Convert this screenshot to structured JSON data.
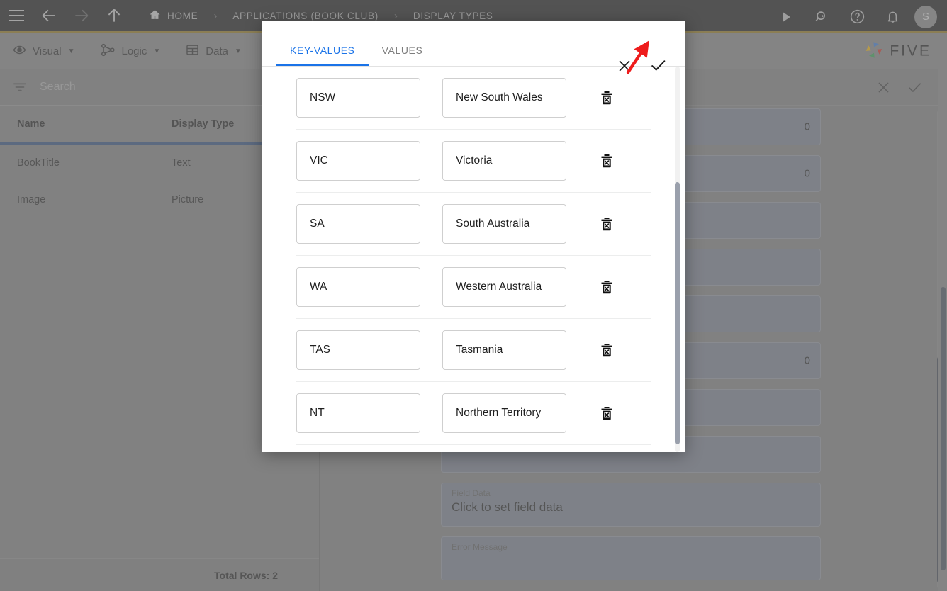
{
  "topbar": {
    "menu_icon": "hamburger-icon",
    "back_icon": "arrow-left-icon",
    "forward_icon": "arrow-right-icon",
    "up_icon": "arrow-up-icon",
    "breadcrumbs": [
      {
        "label": "HOME",
        "icon": "home-icon"
      },
      {
        "label": "APPLICATIONS (BOOK CLUB)",
        "icon": ""
      },
      {
        "label": "DISPLAY TYPES",
        "icon": ""
      }
    ],
    "separator": "›",
    "actions": [
      {
        "name": "run-icon",
        "glyph": "play"
      },
      {
        "name": "search-global-icon",
        "glyph": "search"
      },
      {
        "name": "help-icon",
        "glyph": "help"
      },
      {
        "name": "notifications-icon",
        "glyph": "bell"
      }
    ],
    "avatar_initial": "S",
    "accent_underline": "#9a7c1d"
  },
  "toolbar": {
    "items": [
      {
        "label": "Visual",
        "icon": "eye-icon",
        "caret": "▼"
      },
      {
        "label": "Logic",
        "icon": "logic-nodes-icon",
        "caret": "▼"
      },
      {
        "label": "Data",
        "icon": "grid-table-icon",
        "caret": "▼"
      }
    ],
    "brand": "FIVE",
    "brand_colors": [
      "#3b7ddd",
      "#d93025",
      "#34a853",
      "#fbbc04"
    ]
  },
  "left_panel": {
    "search": {
      "placeholder": "Search",
      "value": "",
      "filter_icon": "filter-icon"
    },
    "columns": [
      "Name",
      "Display Type"
    ],
    "rows": [
      {
        "name": "BookTitle",
        "display_type": "Text"
      },
      {
        "name": "Image",
        "display_type": "Picture"
      }
    ],
    "footer": "Total Rows: 2"
  },
  "right_panel": {
    "actions": [
      {
        "name": "cancel-record-icon",
        "glyph": "✕"
      },
      {
        "name": "save-record-icon",
        "glyph": "✓"
      }
    ],
    "fields": [
      {
        "label": "",
        "value_right": "0",
        "value_left": ""
      },
      {
        "label": "",
        "value_right": "0",
        "value_left": ""
      },
      {
        "label": "",
        "value_right": "",
        "value_left": ""
      },
      {
        "label": "",
        "value_right": "",
        "value_left": ""
      },
      {
        "label": "",
        "value_right": "",
        "value_left": ""
      },
      {
        "label": "",
        "value_right": "0",
        "value_left": ""
      },
      {
        "label": "",
        "value_right": "",
        "value_left": ""
      },
      {
        "label": "",
        "value_right": "",
        "value_left": ""
      },
      {
        "label": "Field Data",
        "value_right": "",
        "value_left": "Click to set field data"
      },
      {
        "label": "Error Message",
        "value_right": "",
        "value_left": ""
      }
    ]
  },
  "modal": {
    "tabs": [
      {
        "label": "KEY-VALUES",
        "active": true
      },
      {
        "label": "VALUES",
        "active": false
      }
    ],
    "close_label": "✕",
    "confirm_label": "✓",
    "active_tab_color": "#1a73e8",
    "delete_icon": "trash-delete-icon",
    "rows": [
      {
        "key": "NSW",
        "value": "New South Wales"
      },
      {
        "key": "VIC",
        "value": "Victoria"
      },
      {
        "key": "SA",
        "value": "South Australia"
      },
      {
        "key": "WA",
        "value": "Western Australia"
      },
      {
        "key": "TAS",
        "value": "Tasmania"
      },
      {
        "key": "NT",
        "value": "Northern Territory"
      }
    ]
  },
  "annotation": {
    "arrow_color": "#ee1c1c",
    "points_to": "modal-confirm-button"
  }
}
